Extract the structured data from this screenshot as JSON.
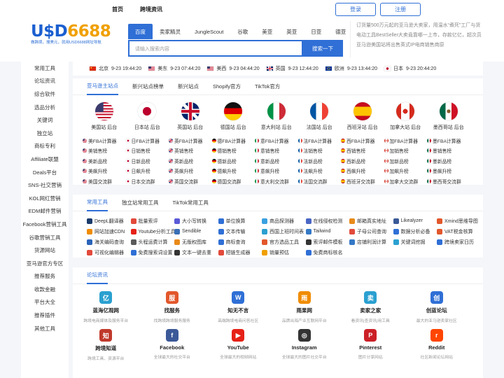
{
  "nav": {
    "home": "首页",
    "crossborder": "跨境资讯",
    "login": "登录",
    "register": "注册"
  },
  "logo": {
    "part1": "U$D",
    "part2": "6688",
    "slogan": "做跨境，搜美元，就用USD6688网址导航"
  },
  "search": {
    "tabs": [
      "百度",
      "卖家精灵",
      "JungleScout",
      "谷歌",
      "美亚",
      "英亚",
      "日亚",
      "德亚"
    ],
    "placeholder": "请输入搜索内容",
    "button": "搜索一下"
  },
  "news": [
    "订货量500万元起的亚马逊大卖家，用温水“煮死”工厂与货",
    "电动工具BestSeller大卖竟靠哪一上市，存款亿亿，超次员",
    "亚马逊美国站将出售英式IP电商销售商原"
  ],
  "sidebar": [
    "常用工具",
    "论坛资讯",
    "综合软件",
    "选品分析",
    "关键词",
    "独立站",
    "商标专利",
    "Affiliate联盟",
    "Deals平台",
    "SNS-社交营销",
    "KOL网红营销",
    "EDM邮件营销",
    "Facebook营销工具",
    "谷歌营销工具",
    "货源网站",
    "亚马逊官方专区",
    "推荐服务",
    "收款金融",
    "平台大全",
    "推荐插件",
    "其他工具"
  ],
  "clocks": [
    {
      "city": "北京",
      "time": "9-23 19:44:20",
      "flag": "cn"
    },
    {
      "city": "美东",
      "time": "9-23 07:44:20",
      "flag": "us"
    },
    {
      "city": "美西",
      "time": "9-23 04:44:20",
      "flag": "us"
    },
    {
      "city": "英国",
      "time": "9-23 12:44:20",
      "flag": "uk"
    },
    {
      "city": "欧洲",
      "time": "9-23 13:44:20",
      "flag": "eu"
    },
    {
      "city": "日本",
      "time": "9-23 20:44:20",
      "flag": "jp"
    }
  ],
  "amazon_tabs": [
    "亚马逊主站点",
    "新兴站点榜单",
    "新兴站点",
    "Shopify官方",
    "TikTok官方"
  ],
  "sites": [
    {
      "name": "美国站 后台",
      "flag": "us"
    },
    {
      "name": "日本站 后台",
      "flag": "jp"
    },
    {
      "name": "英国站 后台",
      "flag": "uk"
    },
    {
      "name": "德国站 后台",
      "flag": "de"
    },
    {
      "name": "意大利站 后台",
      "flag": "it"
    },
    {
      "name": "法国站 后台",
      "flag": "fr"
    },
    {
      "name": "西班牙站 后台",
      "flag": "es"
    },
    {
      "name": "加拿大站 后台",
      "flag": "ca"
    },
    {
      "name": "墨西哥站 后台",
      "flag": "mx"
    }
  ],
  "site_links": [
    [
      {
        "t": "美FBA计算器",
        "f": "us"
      },
      {
        "t": "日FBA计算器",
        "f": "jp"
      },
      {
        "t": "英FBA计算器",
        "f": "uk"
      },
      {
        "t": "德FBA计算器",
        "f": "de"
      },
      {
        "t": "意FBA计算器",
        "f": "it"
      },
      {
        "t": "法FBA计算器",
        "f": "fr"
      },
      {
        "t": "西FBA计算器",
        "f": "es"
      },
      {
        "t": "加FBA计算器",
        "f": "ca"
      },
      {
        "t": "墨FBA计算器",
        "f": "mx"
      }
    ],
    [
      {
        "t": "美销售榜",
        "f": "us"
      },
      {
        "t": "日销售榜",
        "f": "jp"
      },
      {
        "t": "英销售榜",
        "f": "uk"
      },
      {
        "t": "德销售榜",
        "f": "de"
      },
      {
        "t": "意销售榜",
        "f": "it"
      },
      {
        "t": "法销售榜",
        "f": "fr"
      },
      {
        "t": "西销售榜",
        "f": "es"
      },
      {
        "t": "加销售榜",
        "f": "ca"
      },
      {
        "t": "墨销售榜",
        "f": "mx"
      }
    ],
    [
      {
        "t": "美新品榜",
        "f": "us"
      },
      {
        "t": "日新品榜",
        "f": "jp"
      },
      {
        "t": "英新品榜",
        "f": "uk"
      },
      {
        "t": "德新品榜",
        "f": "de"
      },
      {
        "t": "意新品榜",
        "f": "it"
      },
      {
        "t": "法新品榜",
        "f": "fr"
      },
      {
        "t": "西新品榜",
        "f": "es"
      },
      {
        "t": "加新品榜",
        "f": "ca"
      },
      {
        "t": "墨新品榜",
        "f": "mx"
      }
    ],
    [
      {
        "t": "美飙升榜",
        "f": "us"
      },
      {
        "t": "日飙升榜",
        "f": "jp"
      },
      {
        "t": "英飙升榜",
        "f": "uk"
      },
      {
        "t": "德飙升榜",
        "f": "de"
      },
      {
        "t": "意飙升榜",
        "f": "it"
      },
      {
        "t": "法飙升榜",
        "f": "fr"
      },
      {
        "t": "西飙升榜",
        "f": "es"
      },
      {
        "t": "加飙升榜",
        "f": "ca"
      },
      {
        "t": "墨飙升榜",
        "f": "mx"
      }
    ],
    [
      {
        "t": "美国交流群",
        "f": "us"
      },
      {
        "t": "日本交流群",
        "f": "jp"
      },
      {
        "t": "英国交流群",
        "f": "uk"
      },
      {
        "t": "德国交流群",
        "f": "de"
      },
      {
        "t": "意大利交流群",
        "f": "it"
      },
      {
        "t": "法国交流群",
        "f": "fr"
      },
      {
        "t": "西班牙交流群",
        "f": "es"
      },
      {
        "t": "加拿大交流群",
        "f": "ca"
      },
      {
        "t": "墨西哥交流群",
        "f": "mx"
      }
    ]
  ],
  "tool_tabs": [
    "常用工具",
    "独立站常用工具",
    "TikTok常用工具"
  ],
  "tools": [
    {
      "t": "DeepL翻译器",
      "c": "#1a3a6b"
    },
    {
      "t": "批量索评",
      "c": "#e24a3b"
    },
    {
      "t": "大小写转换",
      "c": "#5a5ad6"
    },
    {
      "t": "单位换算",
      "c": "#2f6fd6"
    },
    {
      "t": "商品探测器",
      "c": "#3aa0e0"
    },
    {
      "t": "在线侵权检测",
      "c": "#4a66c4"
    },
    {
      "t": "邮箱真实地址",
      "c": "#e88a1a"
    },
    {
      "t": "Likealyzer",
      "c": "#3b5998"
    },
    {
      "t": "Xmind思维导图",
      "c": "#e2572b"
    },
    {
      "t": "网站加速CDN",
      "c": "#f08c00"
    },
    {
      "t": "Youtube分析工具",
      "c": "#e62117"
    },
    {
      "t": "Sendible",
      "c": "#3a6fb6"
    },
    {
      "t": "文本传输",
      "c": "#2f6fd6"
    },
    {
      "t": "西国上班时间表",
      "c": "#2aa0d0"
    },
    {
      "t": "Tailwind",
      "c": "#3478c6"
    },
    {
      "t": "子母公司查询",
      "c": "#e24a3b"
    },
    {
      "t": "数据分析必备",
      "c": "#2f6fd6"
    },
    {
      "t": "VAT税金核算",
      "c": "#e2572b"
    },
    {
      "t": "海关编码查询",
      "c": "#2a63b8"
    },
    {
      "t": "头程运费计算",
      "c": "#5a5a5a"
    },
    {
      "t": "无版权图库",
      "c": "#e88a1a"
    },
    {
      "t": "商标查询",
      "c": "#2f6fd6"
    },
    {
      "t": "官方选品工具",
      "c": "#e2572b"
    },
    {
      "t": "索评邮件模板",
      "c": "#333333"
    },
    {
      "t": "店铺利润计算",
      "c": "#3478c6"
    },
    {
      "t": "关键词挖掘",
      "c": "#2aa0d0"
    },
    {
      "t": "跨境卖家日历",
      "c": "#2f6fd6"
    },
    {
      "t": "可视化编辑器",
      "c": "#e24a3b"
    },
    {
      "t": "免费搜索词设置",
      "c": "#2f6fd6"
    },
    {
      "t": "文本一键去重",
      "c": "#333333"
    },
    {
      "t": "短链生成器",
      "c": "#e24a3b"
    },
    {
      "t": "销量预估",
      "c": "#f0a000"
    },
    {
      "t": "免费商标核名",
      "c": "#2f6fd6"
    }
  ],
  "forum_tab": "论坛资讯",
  "forums": [
    {
      "name": "蓝海亿观网",
      "desc": "跨境电商媒体及服务平台",
      "c": "#2aa0d0",
      "g": "亿"
    },
    {
      "name": "找服务",
      "desc": "找跨境跨境服务服务",
      "c": "#e2572b",
      "g": "服"
    },
    {
      "name": "知无不言",
      "desc": "高端跨境电商问答社区",
      "c": "#2f6fd6",
      "g": "W"
    },
    {
      "name": "雨果网",
      "desc": "品牌出海产业互联网平台",
      "c": "#f08c00",
      "g": "雨"
    },
    {
      "name": "卖家之家",
      "desc": "看资讯|查资讯|用工具",
      "c": "#2aa0d0",
      "g": "卖"
    },
    {
      "name": "创蓝论坛",
      "desc": "最大的亚马逊卖家社区",
      "c": "#2f6fd6",
      "g": "创"
    },
    {
      "name": "跨境知道",
      "desc": "跨境工具、资源平台",
      "c": "#c0392b",
      "g": "知"
    },
    {
      "name": "Facebook",
      "desc": "全球最大的社交平台",
      "c": "#3b5998",
      "g": "f"
    },
    {
      "name": "YouTube",
      "desc": "全球最大的视频网站",
      "c": "#e62117",
      "g": "▶"
    },
    {
      "name": "Instagram",
      "desc": "全球最大的图片社交平台",
      "c": "#333333",
      "g": "◎"
    },
    {
      "name": "Pinterest",
      "desc": "图片分享网站",
      "c": "#cb2027",
      "g": "P"
    },
    {
      "name": "Reddit",
      "desc": "社区新闻论坛网站",
      "c": "#ff4500",
      "g": "r"
    }
  ]
}
